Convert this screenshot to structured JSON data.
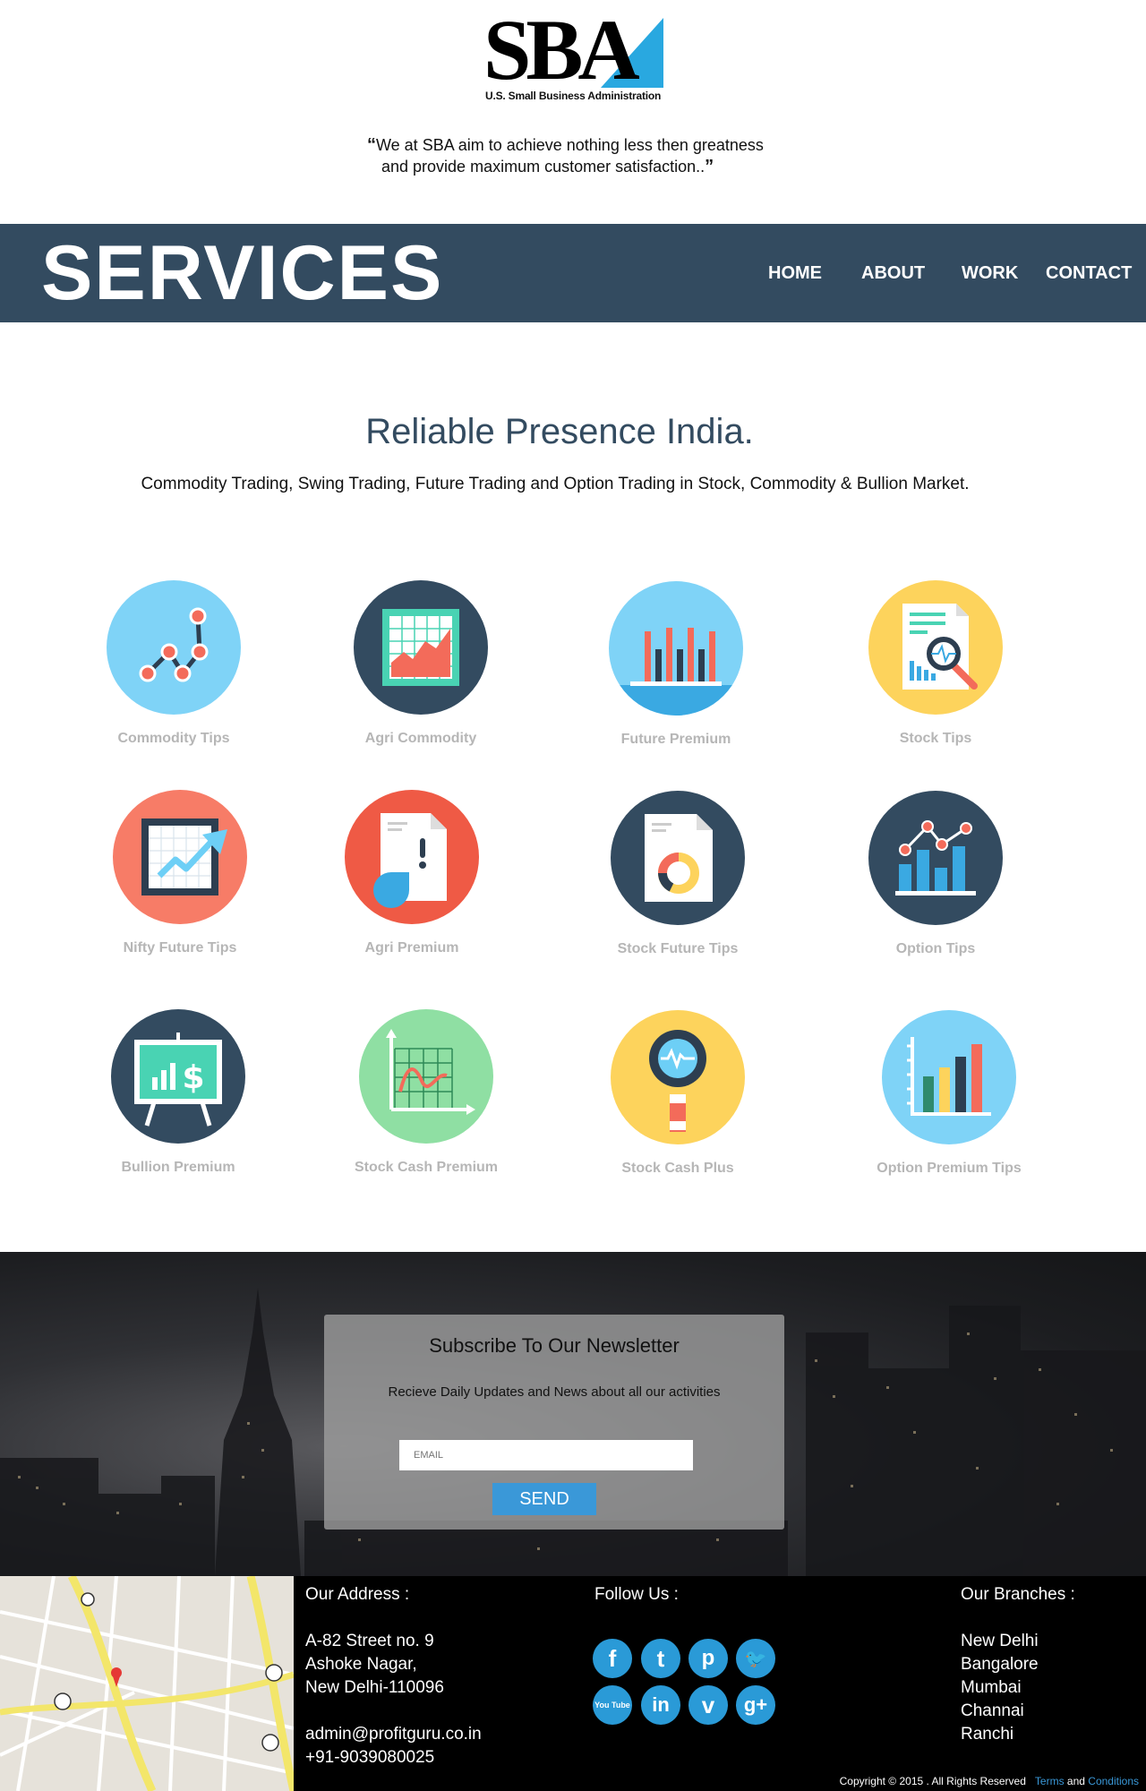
{
  "brand": {
    "logo_text": "SBA",
    "logo_subtitle": "U.S. Small Business Administration",
    "quote_line1": "We at SBA aim to achieve nothing less then greatness",
    "quote_line2": "and provide maximum customer satisfaction..",
    "open_quote": "“",
    "close_quote": "”"
  },
  "nav": {
    "title": "SERVICES",
    "links": [
      {
        "label": "HOME"
      },
      {
        "label": "ABOUT"
      },
      {
        "label": "WORK"
      },
      {
        "label": "CONTACT"
      }
    ]
  },
  "intro": {
    "headline": "Reliable Presence India.",
    "subline": "Commodity Trading, Swing Trading, Future Trading and Option Trading in Stock, Commodity & Bullion Market."
  },
  "services": [
    {
      "label": "Commodity Tips",
      "icon": "scatter-line-icon",
      "color": "#7fd3f7"
    },
    {
      "label": "Agri Commodity",
      "icon": "area-chart-icon",
      "color": "#334b60"
    },
    {
      "label": "Future Premium",
      "icon": "bar-chart-icon",
      "color": "#7fd3f7"
    },
    {
      "label": "Stock Tips",
      "icon": "report-magnifier-icon",
      "color": "#fdd35c"
    },
    {
      "label": "Nifty Future Tips",
      "icon": "trend-up-icon",
      "color": "#f77c67"
    },
    {
      "label": "Agri Premium",
      "icon": "document-alert-icon",
      "color": "#ef5a45"
    },
    {
      "label": "Stock Future Tips",
      "icon": "document-donut-icon",
      "color": "#334b60"
    },
    {
      "label": "Option Tips",
      "icon": "bar-line-combo-icon",
      "color": "#334b60"
    },
    {
      "label": "Bullion Premium",
      "icon": "dollar-board-icon",
      "color": "#334b60"
    },
    {
      "label": "Stock Cash Premium",
      "icon": "graph-paper-icon",
      "color": "#8fdfa3"
    },
    {
      "label": "Stock Cash Plus",
      "icon": "magnifier-pulse-icon",
      "color": "#fdd35c"
    },
    {
      "label": "Option Premium Tips",
      "icon": "colored-bars-icon",
      "color": "#7fd3f7"
    }
  ],
  "newsletter": {
    "title": "Subscribe To Our Newsletter",
    "description": "Recieve Daily Updates and News about all our activities",
    "email_placeholder": "EMAIL",
    "send_label": "SEND"
  },
  "footer": {
    "address_title": "Our Address :",
    "address_lines": [
      "A-82 Street no. 9",
      "Ashoke Nagar,",
      "New Delhi-110096"
    ],
    "email": "admin@profitguru.co.in",
    "phone": "+91-9039080025",
    "follow_title": "Follow Us :",
    "social": [
      {
        "icon": "facebook-icon",
        "glyph": "f"
      },
      {
        "icon": "tumblr-icon",
        "glyph": "t"
      },
      {
        "icon": "pinterest-icon",
        "glyph": "p"
      },
      {
        "icon": "twitter-icon",
        "glyph": "🐦"
      },
      {
        "icon": "youtube-icon",
        "glyph": "You Tube"
      },
      {
        "icon": "linkedin-icon",
        "glyph": "in"
      },
      {
        "icon": "vimeo-icon",
        "glyph": "v"
      },
      {
        "icon": "google-plus-icon",
        "glyph": "g+"
      }
    ],
    "branches_title": "Our Branches :",
    "branches": [
      "New Delhi",
      "Bangalore",
      "Mumbai",
      "Channai",
      "Ranchi"
    ],
    "copyright_text": "Copyright © 2015 . All Rights Reserved",
    "terms_label": "Terms",
    "and_label": "and",
    "conditions_label": "Conditions"
  }
}
